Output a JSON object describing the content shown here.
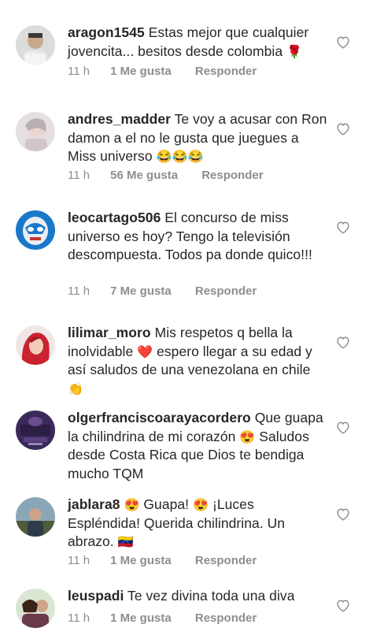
{
  "comments": [
    {
      "user": "aragon1545",
      "text": "Estas mejor que cualquier jovencita... besitos desde colombia",
      "emoji": "🌹",
      "time": "11 h",
      "likes": "1 Me gusta",
      "reply": "Responder"
    },
    {
      "user": "andres_madder",
      "text": "Te voy a  acusar con Ron damon  a el no le gusta que juegues a Miss universo",
      "emoji": "😂😂😂",
      "time": "11 h",
      "likes": "56 Me gusta",
      "reply": "Responder"
    },
    {
      "user": "leocartago506",
      "text": "El concurso de miss universo es hoy? Tengo la televisión descompuesta. Todos pa donde quico!!!",
      "emoji": "",
      "time": "11 h",
      "likes": "7 Me gusta",
      "reply": "Responder"
    },
    {
      "user": "lilimar_moro",
      "text_a": "Mis respetos q bella la inolvidable",
      "emoji_a": "❤️",
      "text_b": "espero llegar a su edad y así saludos de una venezolana en chile",
      "emoji_b": "👏"
    },
    {
      "user": "olgerfranciscoarayacordero",
      "text_a": "Que guapa la chilindrina de mi corazón",
      "emoji_a": "😍",
      "text_b": "Saludos desde Costa Rica que Dios te bendiga mucho TQM"
    },
    {
      "user": "jablara8",
      "emoji_a": "😍",
      "text_a": "Guapa!",
      "emoji_b": "😍",
      "text_b": "¡Luces Espléndida! Querida chilindrina. Un abrazo.",
      "emoji_c": "🇻🇪",
      "time": "11 h",
      "likes": "1 Me gusta",
      "reply": "Responder"
    },
    {
      "user": "leuspadi",
      "text": "Te vez divina toda una diva",
      "time": "11 h",
      "likes": "1 Me gusta",
      "reply": "Responder"
    }
  ],
  "colors": {
    "text": "#262626",
    "meta": "#8e8e8e",
    "heart_outline": "#8e8e8e"
  },
  "icons": {
    "like": "heart-outline-icon"
  }
}
